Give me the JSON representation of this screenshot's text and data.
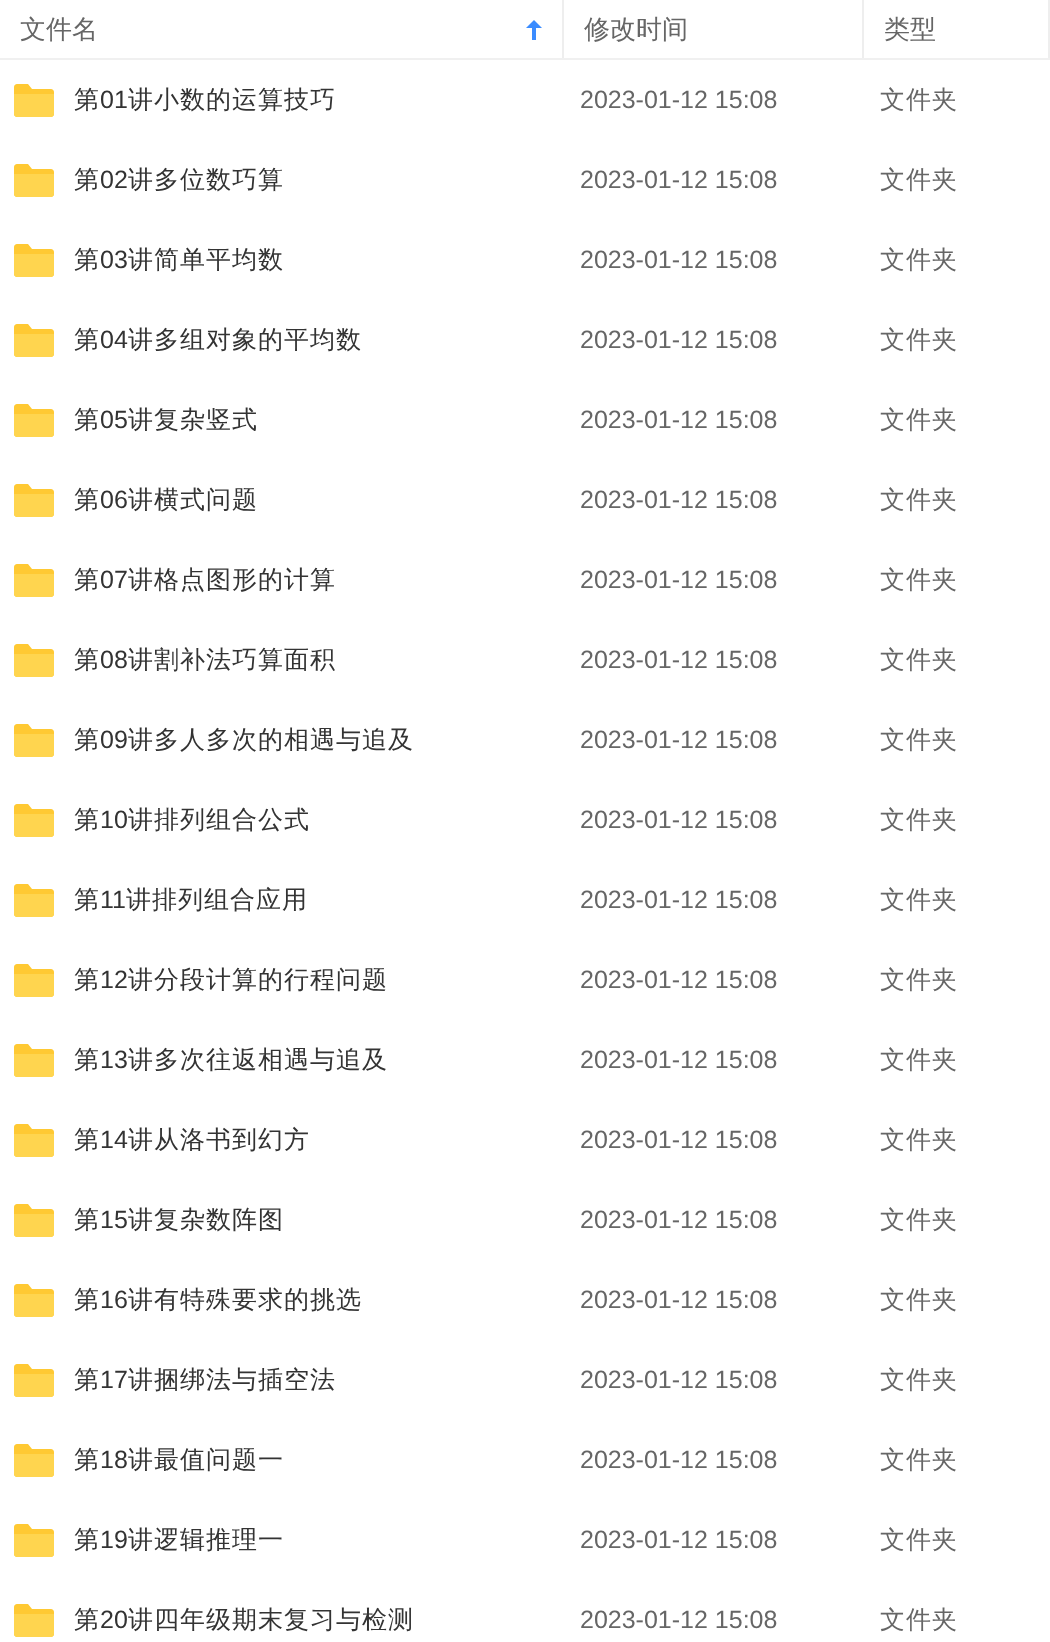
{
  "table": {
    "columns": [
      {
        "label": "文件名",
        "sorted": true
      },
      {
        "label": "修改时间",
        "sorted": false
      },
      {
        "label": "类型",
        "sorted": false
      }
    ],
    "rows": [
      {
        "name": "第01讲小数的运算技巧",
        "modified": "2023-01-12 15:08",
        "type": "文件夹"
      },
      {
        "name": "第02讲多位数巧算",
        "modified": "2023-01-12 15:08",
        "type": "文件夹"
      },
      {
        "name": "第03讲简单平均数",
        "modified": "2023-01-12 15:08",
        "type": "文件夹"
      },
      {
        "name": "第04讲多组对象的平均数",
        "modified": "2023-01-12 15:08",
        "type": "文件夹"
      },
      {
        "name": "第05讲复杂竖式",
        "modified": "2023-01-12 15:08",
        "type": "文件夹"
      },
      {
        "name": "第06讲横式问题",
        "modified": "2023-01-12 15:08",
        "type": "文件夹"
      },
      {
        "name": "第07讲格点图形的计算",
        "modified": "2023-01-12 15:08",
        "type": "文件夹"
      },
      {
        "name": "第08讲割补法巧算面积",
        "modified": "2023-01-12 15:08",
        "type": "文件夹"
      },
      {
        "name": "第09讲多人多次的相遇与追及",
        "modified": "2023-01-12 15:08",
        "type": "文件夹"
      },
      {
        "name": "第10讲排列组合公式",
        "modified": "2023-01-12 15:08",
        "type": "文件夹"
      },
      {
        "name": "第11讲排列组合应用",
        "modified": "2023-01-12 15:08",
        "type": "文件夹"
      },
      {
        "name": "第12讲分段计算的行程问题",
        "modified": "2023-01-12 15:08",
        "type": "文件夹"
      },
      {
        "name": "第13讲多次往返相遇与追及",
        "modified": "2023-01-12 15:08",
        "type": "文件夹"
      },
      {
        "name": "第14讲从洛书到幻方",
        "modified": "2023-01-12 15:08",
        "type": "文件夹"
      },
      {
        "name": "第15讲复杂数阵图",
        "modified": "2023-01-12 15:08",
        "type": "文件夹"
      },
      {
        "name": "第16讲有特殊要求的挑选",
        "modified": "2023-01-12 15:08",
        "type": "文件夹"
      },
      {
        "name": "第17讲捆绑法与插空法",
        "modified": "2023-01-12 15:08",
        "type": "文件夹"
      },
      {
        "name": "第18讲最值问题一",
        "modified": "2023-01-12 15:08",
        "type": "文件夹"
      },
      {
        "name": "第19讲逻辑推理一",
        "modified": "2023-01-12 15:08",
        "type": "文件夹"
      },
      {
        "name": "第20讲四年级期末复习与检测",
        "modified": "2023-01-12 15:08",
        "type": "文件夹"
      }
    ]
  }
}
